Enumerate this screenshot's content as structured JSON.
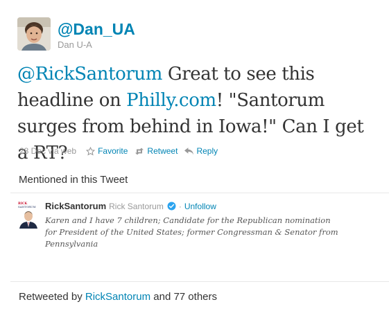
{
  "author": {
    "handle": "@Dan_UA",
    "name": "Dan U-A"
  },
  "tweet": {
    "mention": "@RickSantorum",
    "part1": " Great to see this headline on ",
    "link": "Philly.com",
    "part2": "! \"Santorum surges from behind in Iowa!\" Can I get a RT?",
    "date": "28 Dec",
    "via": "via web"
  },
  "actions": {
    "favorite": "Favorite",
    "retweet": "Retweet",
    "reply": "Reply"
  },
  "mentioned": {
    "title": "Mentioned in this Tweet",
    "user": {
      "screen_name": "RickSantorum",
      "real_name": "Rick Santorum",
      "unfollow": "Unfollow",
      "bio": "Karen and I have 7 children; Candidate for the Republican nomination for President of the United States; former Congressman & Senator from Pennsylvania",
      "logo_top": "RICK",
      "logo_bottom": "SANTORUM"
    }
  },
  "retweets": {
    "prefix": "Retweeted by ",
    "user": "RickSantorum",
    "suffix": " and 77 others"
  },
  "colors": {
    "link": "#0084b4",
    "verified": "#2aa3ef"
  }
}
